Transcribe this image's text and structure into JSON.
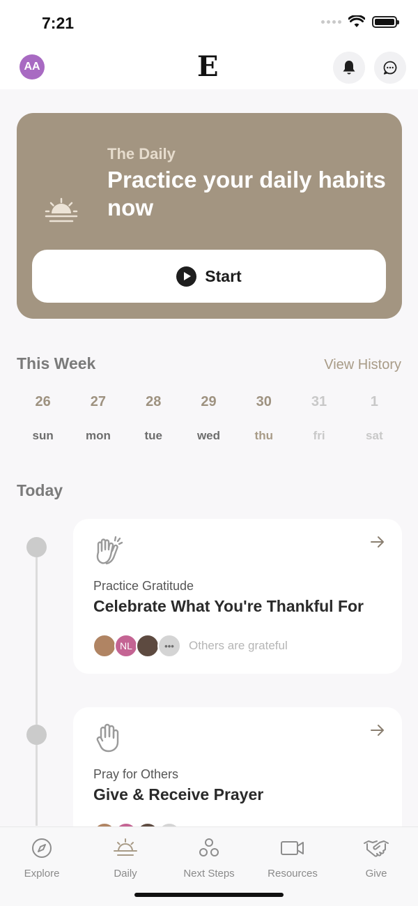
{
  "status_bar": {
    "time": "7:21"
  },
  "header": {
    "avatar_initials": "AA",
    "logo": "E",
    "icons": [
      "bell-icon",
      "chat-icon"
    ]
  },
  "hero": {
    "eyebrow": "The Daily",
    "title": "Practice your daily habits now",
    "start_label": "Start"
  },
  "week": {
    "title": "This Week",
    "view_history": "View History",
    "days": [
      {
        "num": "26",
        "name": "sun",
        "state": "past"
      },
      {
        "num": "27",
        "name": "mon",
        "state": "past"
      },
      {
        "num": "28",
        "name": "tue",
        "state": "past"
      },
      {
        "num": "29",
        "name": "wed",
        "state": "past"
      },
      {
        "num": "30",
        "name": "thu",
        "state": "current"
      },
      {
        "num": "31",
        "name": "fri",
        "state": "future"
      },
      {
        "num": "1",
        "name": "sat",
        "state": "future"
      }
    ]
  },
  "today": {
    "title": "Today",
    "cards": [
      {
        "category": "Practice Gratitude",
        "title": "Celebrate What You're Thankful For",
        "avatar_initials": "NL",
        "people_label": "Others are grateful",
        "icon": "clapping-hands-icon"
      },
      {
        "category": "Pray for Others",
        "title": "Give & Receive Prayer",
        "icon": "raised-hand-icon"
      }
    ]
  },
  "tabs": [
    {
      "label": "Explore",
      "icon": "compass-icon"
    },
    {
      "label": "Daily",
      "icon": "sunrise-icon",
      "active": true
    },
    {
      "label": "Next Steps",
      "icon": "circles-icon"
    },
    {
      "label": "Resources",
      "icon": "video-camera-icon"
    },
    {
      "label": "Give",
      "icon": "handshake-icon"
    }
  ],
  "colors": {
    "accent": "#a39581",
    "avatar": "#a86ac2"
  }
}
